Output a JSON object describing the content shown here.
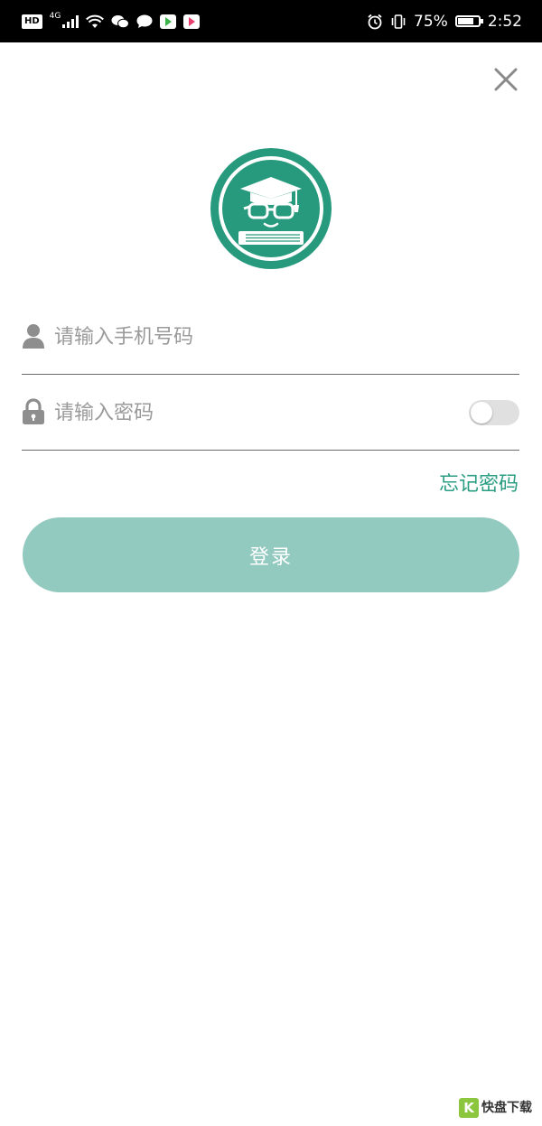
{
  "status_bar": {
    "hd": "HD",
    "network": "4G",
    "battery": "75%",
    "time": "2:52"
  },
  "icons": {
    "close": "close-icon",
    "user": "user-icon",
    "lock": "lock-icon",
    "logo": "graduate-logo"
  },
  "login": {
    "phone_placeholder": "请输入手机号码",
    "password_placeholder": "请输入密码",
    "password_visible": false,
    "forgot_password": "忘记密码",
    "login_button": "登录"
  },
  "watermark": {
    "badge": "K",
    "main": "快盘下载"
  },
  "colors": {
    "accent": "#2a9d82",
    "logo_green": "#279a7d",
    "button": "#93cabf",
    "status_bar": "#000000"
  }
}
